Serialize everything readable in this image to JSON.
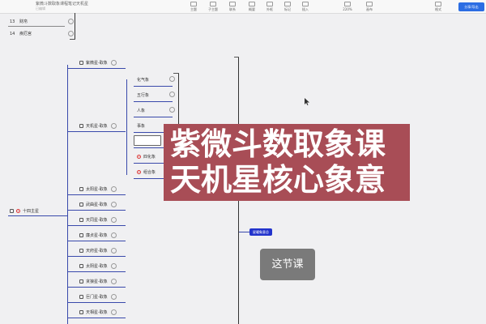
{
  "toolbar": {
    "doc_title": "紫微斗数取象课程笔记天机星",
    "doc_sub": "已编辑",
    "items": [
      "主题",
      "子主题",
      "联系",
      "概要",
      "外框",
      "标记",
      "插入",
      "",
      "",
      "",
      "",
      "",
      "",
      "",
      "",
      "",
      "",
      "",
      "",
      "",
      "",
      "220%",
      "画布",
      "格式"
    ],
    "share_label": "分享/导出"
  },
  "top_nodes": [
    {
      "num": "13",
      "label": "财帛"
    },
    {
      "num": "14",
      "label": "疾厄宫"
    }
  ],
  "root": {
    "label": "十四主星"
  },
  "stars": [
    {
      "label": "紫微星-取象"
    },
    {
      "label": "天机星-取象"
    },
    {
      "label": "太阳星-取象"
    },
    {
      "label": "武曲星-取象"
    },
    {
      "label": "天同星-取象"
    },
    {
      "label": "廉贞星-取象"
    },
    {
      "label": "天府星-取象"
    },
    {
      "label": "太阴星-取象"
    },
    {
      "label": "贪狼星-取象"
    },
    {
      "label": "巨门星-取象"
    },
    {
      "label": "天相星-取象"
    }
  ],
  "tianji_children": [
    {
      "label": "化气象"
    },
    {
      "label": "五行象"
    },
    {
      "label": "人象"
    },
    {
      "label": "事象"
    },
    {
      "label": "物象"
    },
    {
      "label": "四化象"
    },
    {
      "label": "组合象"
    }
  ],
  "blue_tags": {
    "right": "星曜象意总"
  },
  "overlay": {
    "line1": "紫微斗数取象课",
    "line2": "天机星核心象意"
  },
  "badge": "这节课",
  "colors": {
    "accent": "#2b6de3",
    "overlay_bg": "#a84d56",
    "badge_bg": "#7a7a7a",
    "tag_bg": "#2233cc"
  }
}
